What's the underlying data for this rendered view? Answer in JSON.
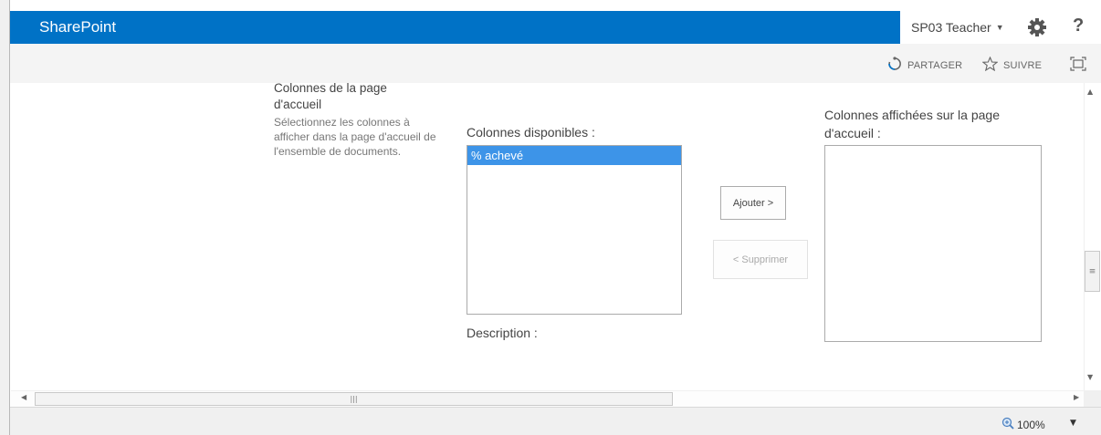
{
  "suite_bar": {
    "brand": "SharePoint",
    "user_name": "SP03 Teacher",
    "help_label": "?"
  },
  "command_bar": {
    "share_label": "PARTAGER",
    "follow_label": "SUIVRE"
  },
  "section": {
    "title_line1": "Colonnes de la page",
    "title_line2": "d'accueil",
    "description": "Sélectionnez les colonnes à afficher dans la page d'accueil de l'ensemble de documents."
  },
  "available_columns": {
    "label": "Colonnes disponibles :",
    "options": [
      "% achevé"
    ],
    "selected": "% achevé"
  },
  "buttons": {
    "add": "Ajouter >",
    "remove": "< Supprimer"
  },
  "shown_columns": {
    "label": "Colonnes affichées sur la page d'accueil :",
    "options": []
  },
  "description_label": "Description :",
  "status_bar": {
    "zoom": "100%"
  },
  "colors": {
    "brand_blue": "#0072c6",
    "selection_blue": "#3d94e8"
  },
  "icons": {
    "gear": "gear-icon",
    "help": "help-icon",
    "share": "share-icon",
    "follow": "star-icon",
    "focus": "focus-on-content-icon",
    "zoom": "zoom-magnifier-icon"
  }
}
